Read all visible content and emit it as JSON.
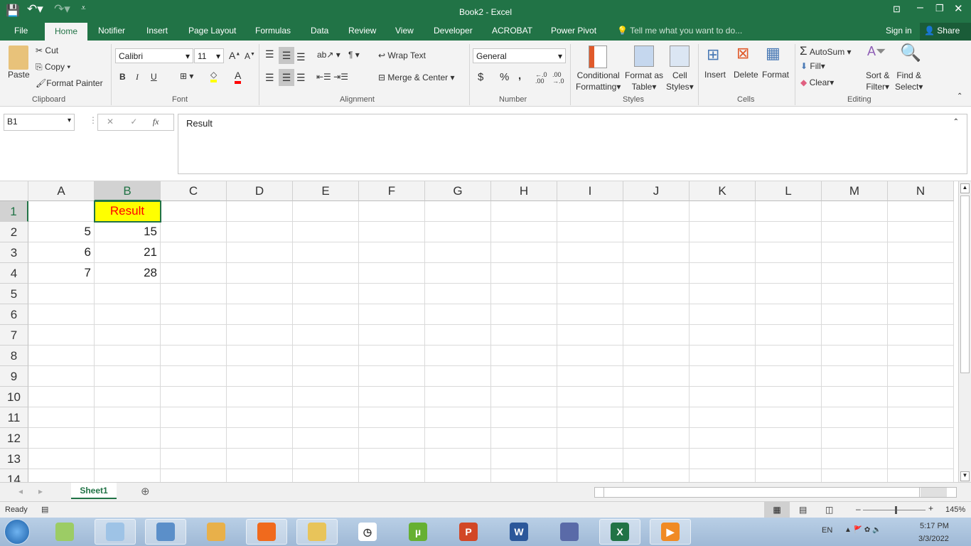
{
  "window": {
    "title": "Book2 - Excel",
    "restore_icon": "ribbon-display-icon"
  },
  "qat": {
    "save": "save-icon",
    "undo": "undo-icon",
    "redo": "redo-icon"
  },
  "tabs": [
    "File",
    "Home",
    "Notifier",
    "Insert",
    "Page Layout",
    "Formulas",
    "Data",
    "Review",
    "View",
    "Developer",
    "ACROBAT",
    "Power Pivot"
  ],
  "active_tab": "Home",
  "tell_me": "Tell me what you want to do...",
  "sign_in": "Sign in",
  "share": "Share",
  "ribbon": {
    "clipboard": {
      "label": "Clipboard",
      "paste": "Paste",
      "cut": "Cut",
      "copy": "Copy",
      "format_painter": "Format Painter"
    },
    "font": {
      "label": "Font",
      "name": "Calibri",
      "size": "11",
      "bold": "B",
      "italic": "I",
      "underline": "U",
      "fill_color": "#ffff00",
      "font_color": "#ff0000"
    },
    "alignment": {
      "label": "Alignment",
      "wrap": "Wrap Text",
      "merge": "Merge & Center"
    },
    "number": {
      "label": "Number",
      "format": "General",
      "currency": "$",
      "percent": "%",
      "comma": ",",
      "inc": "←.0 .00",
      "dec": ".00 →.0"
    },
    "styles": {
      "label": "Styles",
      "cond1": "Conditional",
      "cond2": "Formatting",
      "fmt1": "Format as",
      "fmt2": "Table",
      "cell1": "Cell",
      "cell2": "Styles"
    },
    "cells": {
      "label": "Cells",
      "insert": "Insert",
      "delete": "Delete",
      "format": "Format"
    },
    "editing": {
      "label": "Editing",
      "autosum": "AutoSum",
      "fill": "Fill",
      "clear": "Clear",
      "sort1": "Sort &",
      "sort2": "Filter",
      "find1": "Find &",
      "find2": "Select"
    }
  },
  "formula_bar": {
    "name_box": "B1",
    "fx": "fx",
    "cancel": "✕",
    "enter": "✓",
    "value": "Result"
  },
  "columns": [
    "A",
    "B",
    "C",
    "D",
    "E",
    "F",
    "G",
    "H",
    "I",
    "J",
    "K",
    "L",
    "M",
    "N"
  ],
  "rows": [
    "1",
    "2",
    "3",
    "4",
    "5",
    "6",
    "7",
    "8",
    "9",
    "10",
    "11",
    "12",
    "13",
    "14"
  ],
  "selected_cell": "B1",
  "cells": {
    "B1": "Result",
    "A2": "5",
    "B2": "15",
    "A3": "6",
    "B3": "21",
    "A4": "7",
    "B4": "28"
  },
  "cell_styles": {
    "B1": {
      "fill": "#ffff00",
      "color": "#ff0000",
      "align": "center"
    }
  },
  "sheets": [
    "Sheet1"
  ],
  "status": {
    "ready": "Ready",
    "zoom": "145%",
    "zoom_level": 145
  },
  "taskbar": {
    "apps": [
      "explorer-sticky",
      "notepad",
      "calculator",
      "paint",
      "firefox",
      "file-manager",
      "clock",
      "utorrent",
      "powerpoint",
      "word",
      "setup",
      "excel",
      "media-player"
    ],
    "lang": "EN",
    "time": "5:17 PM",
    "date": "3/3/2022"
  }
}
